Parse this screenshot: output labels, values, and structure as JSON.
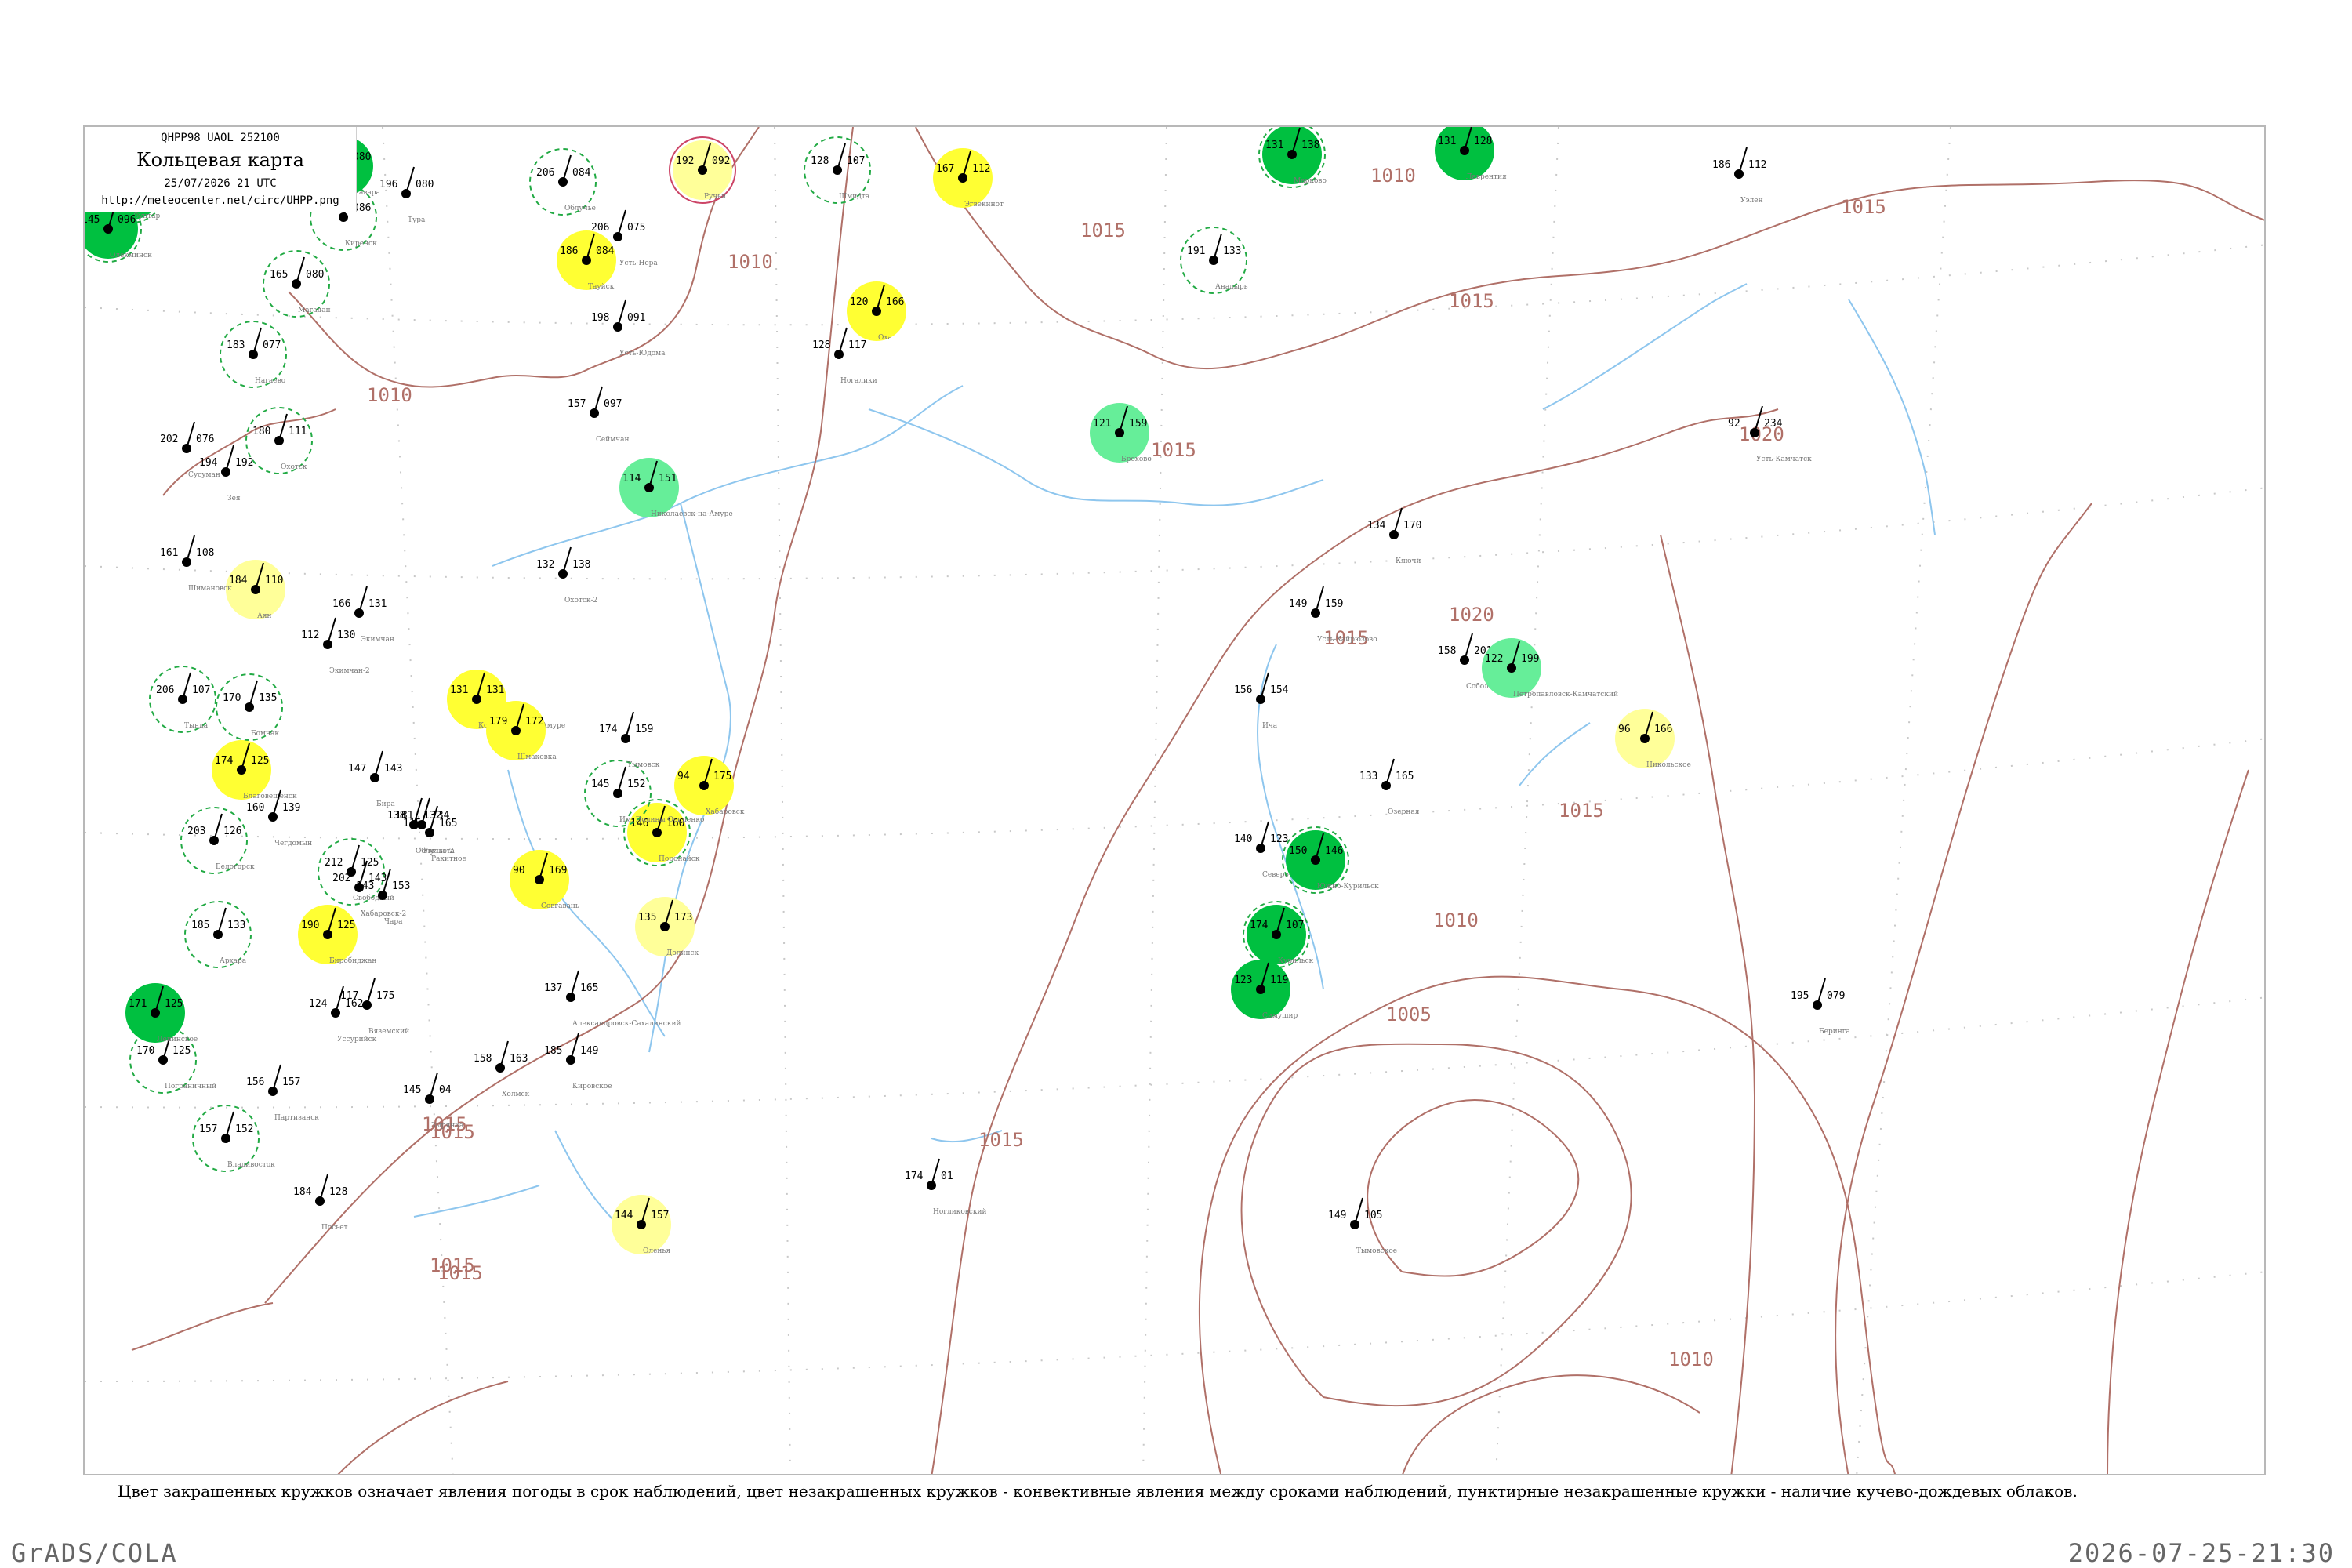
{
  "header": {
    "code": "QHPP98  UAOL  252100",
    "title": "Кольцевая карта",
    "date": "25/07/2026 21 UTC",
    "url": "http://meteocenter.net/circ/UHPP.png"
  },
  "footer": {
    "legend": "Цвет закрашенных кружков означает явления погоды в срок наблюдений, цвет незакрашенных кружков - конвективные явления между сроками наблюдений, пунктирные незакрашенные кружки - наличие кучево-дождевых облаков.",
    "brand": "GrADS/COLA",
    "timestamp": "2026-07-25-21:30"
  },
  "colors": {
    "isobar": "#b07068",
    "river": "#8ec6ee",
    "grid": "#c8c8c8",
    "yellow": "#ffff33",
    "pale_yellow": "#ffff99",
    "green": "#00c040",
    "light_green": "#66ee99",
    "ring_green": "#22aa44",
    "ring_red": "#cc4466"
  },
  "isobar_labels": [
    "1005",
    "1010",
    "1015",
    "1020"
  ],
  "stations": [
    {
      "name": "Магадан",
      "t": "165",
      "p": "080",
      "fill": "none",
      "ring": "dash"
    },
    {
      "name": "Нагаево",
      "t": "183",
      "p": "077",
      "fill": "none",
      "ring": "dash"
    },
    {
      "name": "Сусуман",
      "t": "202",
      "p": "076",
      "fill": "none",
      "ring": "none"
    },
    {
      "name": "Зея",
      "t": "194",
      "p": "192",
      "fill": "none",
      "ring": "none"
    },
    {
      "name": "Охотск",
      "t": "180",
      "p": "111",
      "fill": "none",
      "ring": "dash"
    },
    {
      "name": "Аян",
      "t": "184",
      "p": "110",
      "fill": "pale_yellow",
      "ring": "none"
    },
    {
      "name": "Шимановск",
      "t": "161",
      "p": "108",
      "fill": "none",
      "ring": "none"
    },
    {
      "name": "Экимчан",
      "t": "166",
      "p": "131",
      "fill": "none",
      "ring": "none"
    },
    {
      "name": "Николаевск-на-Амуре",
      "t": "114",
      "p": "151",
      "fill": "light_green",
      "ring": "none"
    },
    {
      "name": "Охотск-2",
      "t": "132",
      "p": "138",
      "fill": "none",
      "ring": "none"
    },
    {
      "name": "Облучье",
      "t": "206",
      "p": "084",
      "fill": "none",
      "ring": "dash"
    },
    {
      "name": "Ручьи",
      "t": "192",
      "p": "092",
      "fill": "pale_yellow",
      "ring": "red"
    },
    {
      "name": "Шмидта",
      "t": "128",
      "p": "107",
      "fill": "none",
      "ring": "dash"
    },
    {
      "name": "Эгвекинот",
      "t": "167",
      "p": "112",
      "fill": "yellow",
      "ring": "none"
    },
    {
      "name": "Оха",
      "t": "120",
      "p": "166",
      "fill": "yellow",
      "ring": "none"
    },
    {
      "name": "Ногалики",
      "t": "128",
      "p": "117",
      "fill": "none",
      "ring": "none"
    },
    {
      "name": "Тауйск",
      "t": "186",
      "p": "084",
      "fill": "yellow",
      "ring": "none"
    },
    {
      "name": "Усть-Юдома",
      "t": "198",
      "p": "091",
      "fill": "none",
      "ring": "none"
    },
    {
      "name": "Сеймчан",
      "t": "157",
      "p": "097",
      "fill": "none",
      "ring": "none"
    },
    {
      "name": "Усть-Нера",
      "t": "206",
      "p": "075",
      "fill": "none",
      "ring": "none"
    },
    {
      "name": "Брохово",
      "t": "121",
      "p": "159",
      "fill": "light_green",
      "ring": "none"
    },
    {
      "name": "Анадырь",
      "t": "191",
      "p": "133",
      "fill": "none",
      "ring": "dash"
    },
    {
      "name": "Марково",
      "t": "131",
      "p": "138",
      "fill": "green",
      "ring": "dash"
    },
    {
      "name": "Лаврентия",
      "t": "131",
      "p": "128",
      "fill": "green",
      "ring": "none"
    },
    {
      "name": "Уэлен",
      "t": "186",
      "p": "112",
      "fill": "none",
      "ring": "none"
    },
    {
      "name": "Усть-Камчатск",
      "t": "92",
      "p": "234",
      "fill": "none",
      "ring": "none"
    },
    {
      "name": "Ключи",
      "t": "134",
      "p": "170",
      "fill": "none",
      "ring": "none"
    },
    {
      "name": "Усть-Хайрюзово",
      "t": "149",
      "p": "159",
      "fill": "none",
      "ring": "none"
    },
    {
      "name": "Соболево",
      "t": "158",
      "p": "201",
      "fill": "none",
      "ring": "none"
    },
    {
      "name": "Петропавловск-Камчатский",
      "t": "122",
      "p": "199",
      "fill": "light_green",
      "ring": "none"
    },
    {
      "name": "Никольское",
      "t": "96",
      "p": "166",
      "fill": "pale_yellow",
      "ring": "none"
    },
    {
      "name": "Ича",
      "t": "156",
      "p": "154",
      "fill": "none",
      "ring": "none"
    },
    {
      "name": "Озерная",
      "t": "133",
      "p": "165",
      "fill": "none",
      "ring": "none"
    },
    {
      "name": "Северо-Курильск",
      "t": "140",
      "p": "123",
      "fill": "none",
      "ring": "none"
    },
    {
      "name": "Южно-Курильск",
      "t": "150",
      "p": "146",
      "fill": "green",
      "ring": "dash"
    },
    {
      "name": "Курильск",
      "t": "174",
      "p": "107",
      "fill": "green",
      "ring": "dash"
    },
    {
      "name": "Симушир",
      "t": "123",
      "p": "119",
      "fill": "green",
      "ring": "none"
    },
    {
      "name": "Беринга",
      "t": "195",
      "p": "079",
      "fill": "none",
      "ring": "none"
    },
    {
      "name": "Ногликовский",
      "t": "174",
      "p": "01",
      "fill": "none",
      "ring": "none"
    },
    {
      "name": "Тымовское",
      "t": "149",
      "p": "105",
      "fill": "none",
      "ring": "none"
    },
    {
      "name": "Хабаровск",
      "t": "94",
      "p": "175",
      "fill": "yellow",
      "ring": "none"
    },
    {
      "name": "Поронайск",
      "t": "146",
      "p": "160",
      "fill": "yellow",
      "ring": "dash"
    },
    {
      "name": "Долинск",
      "t": "135",
      "p": "173",
      "fill": "pale_yellow",
      "ring": "none"
    },
    {
      "name": "Совгавань",
      "t": "90",
      "p": "169",
      "fill": "yellow",
      "ring": "none"
    },
    {
      "name": "Биробиджан",
      "t": "190",
      "p": "125",
      "fill": "yellow",
      "ring": "none"
    },
    {
      "name": "Благовещенск",
      "t": "174",
      "p": "125",
      "fill": "yellow",
      "ring": "none"
    },
    {
      "name": "Комсомольск-на-Амуре",
      "t": "131",
      "p": "131",
      "fill": "yellow",
      "ring": "none"
    },
    {
      "name": "Им. Полины Осипенко",
      "t": "145",
      "p": "152",
      "fill": "none",
      "ring": "dash"
    },
    {
      "name": "Тында",
      "t": "206",
      "p": "107",
      "fill": "none",
      "ring": "dash"
    },
    {
      "name": "Бомнак",
      "t": "170",
      "p": "135",
      "fill": "none",
      "ring": "dash"
    },
    {
      "name": "Белогорск",
      "t": "203",
      "p": "126",
      "fill": "none",
      "ring": "dash"
    },
    {
      "name": "Свободный",
      "t": "212",
      "p": "125",
      "fill": "none",
      "ring": "dash"
    },
    {
      "name": "Архара",
      "t": "185",
      "p": "133",
      "fill": "none",
      "ring": "dash"
    },
    {
      "name": "Пограничный",
      "t": "170",
      "p": "125",
      "fill": "none",
      "ring": "dash"
    },
    {
      "name": "Владивосток",
      "t": "157",
      "p": "152",
      "fill": "none",
      "ring": "dash"
    },
    {
      "name": "Партизанск",
      "t": "156",
      "p": "157",
      "fill": "none",
      "ring": "none"
    },
    {
      "name": "Ленинское",
      "t": "171",
      "p": "125",
      "fill": "green",
      "ring": "none"
    },
    {
      "name": "Уссурийск",
      "t": "124",
      "p": "162",
      "fill": "none",
      "ring": "none"
    },
    {
      "name": "Сунтар",
      "t": "183",
      "p": "096",
      "fill": "green",
      "ring": "dash"
    },
    {
      "name": "Киренск",
      "t": "175",
      "p": "086",
      "fill": "none",
      "ring": "dash"
    },
    {
      "name": "Тура",
      "t": "196",
      "p": "080",
      "fill": "none",
      "ring": "none"
    },
    {
      "name": "Ванавара",
      "t": "181",
      "p": "080",
      "fill": "green",
      "ring": "none"
    },
    {
      "name": "Олекминск",
      "t": "145",
      "p": "096",
      "fill": "green",
      "ring": "dash"
    },
    {
      "name": "Чара",
      "t": "143",
      "p": "153",
      "fill": "none",
      "ring": "none"
    },
    {
      "name": "Экимчан-2",
      "t": "112",
      "p": "130",
      "fill": "none",
      "ring": "none"
    },
    {
      "name": "Бира",
      "t": "147",
      "p": "143",
      "fill": "none",
      "ring": "none"
    },
    {
      "name": "Облучье-2",
      "t": "138",
      "p": "132",
      "fill": "none",
      "ring": "none"
    },
    {
      "name": "Вяземский",
      "t": "117",
      "p": "175",
      "fill": "none",
      "ring": "none"
    },
    {
      "name": "Александровск-Сахалинский",
      "t": "137",
      "p": "165",
      "fill": "none",
      "ring": "none"
    },
    {
      "name": "Кировское",
      "t": "185",
      "p": "149",
      "fill": "none",
      "ring": "none"
    },
    {
      "name": "Оленья",
      "t": "144",
      "p": "157",
      "fill": "pale_yellow",
      "ring": "none"
    },
    {
      "name": "Холмск",
      "t": "158",
      "p": "163",
      "fill": "none",
      "ring": "none"
    },
    {
      "name": "Зырянка",
      "t": "145",
      "p": "04",
      "fill": "none",
      "ring": "none"
    },
    {
      "name": "Посьет",
      "t": "184",
      "p": "128",
      "fill": "none",
      "ring": "none"
    },
    {
      "name": "Ракитное",
      "t": "115",
      "p": "165",
      "fill": "none",
      "ring": "none"
    },
    {
      "name": "Чегдомын",
      "t": "160",
      "p": "139",
      "fill": "none",
      "ring": "none"
    },
    {
      "name": "Шмаковка",
      "t": "179",
      "p": "172",
      "fill": "yellow",
      "ring": "none"
    },
    {
      "name": "Тымовск",
      "t": "174",
      "p": "159",
      "fill": "none",
      "ring": "none"
    },
    {
      "name": "Хабаровск-2",
      "t": "202",
      "p": "143",
      "fill": "none",
      "ring": "none"
    },
    {
      "name": "Умальта",
      "t": "181",
      "p": "134",
      "fill": "none",
      "ring": "none"
    }
  ]
}
